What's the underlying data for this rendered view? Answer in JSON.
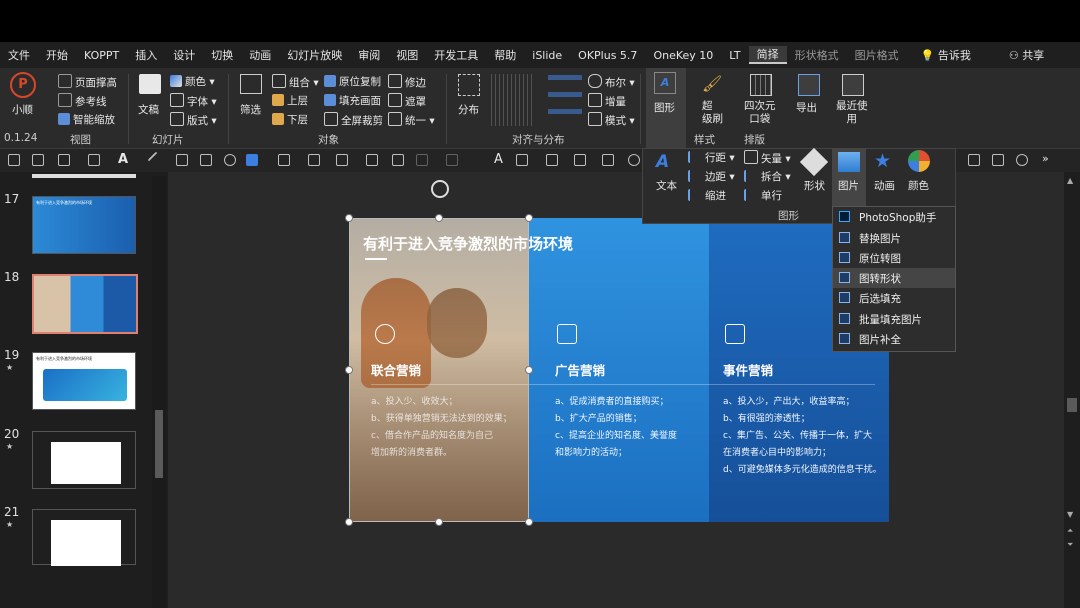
{
  "menubar": {
    "items": [
      {
        "label": "文件"
      },
      {
        "label": "开始"
      },
      {
        "label": "KOPPT"
      },
      {
        "label": "插入"
      },
      {
        "label": "设计"
      },
      {
        "label": "切换"
      },
      {
        "label": "动画"
      },
      {
        "label": "幻灯片放映"
      },
      {
        "label": "审阅"
      },
      {
        "label": "视图"
      },
      {
        "label": "开发工具"
      },
      {
        "label": "帮助"
      },
      {
        "label": "iSlide"
      },
      {
        "label": "OKPlus 5.7"
      },
      {
        "label": "OneKey 10"
      },
      {
        "label": "LT"
      },
      {
        "label": "简择"
      },
      {
        "label": "形状格式"
      },
      {
        "label": "图片格式"
      }
    ],
    "tell_me": "告诉我",
    "share": "共享"
  },
  "ribbon": {
    "xiaoshun": "小顺",
    "version": "0.1.24",
    "view_group": {
      "label": "视图",
      "items": [
        "页面撑高",
        "参考线",
        "智能缩放"
      ]
    },
    "slide_group": {
      "label": "幻灯片",
      "doc": "文稿",
      "items": [
        "颜色",
        "字体",
        "版式"
      ]
    },
    "object_group": {
      "label": "对象",
      "filter": "筛选",
      "items": [
        "组合",
        "上层",
        "下层",
        "原位复制",
        "填充画面",
        "全屏裁剪",
        "修边",
        "遮罩",
        "统一"
      ]
    },
    "align_group": {
      "label": "对齐与分布",
      "distribute": "分布",
      "items": [
        "布尔",
        "增量",
        "模式"
      ]
    },
    "shape_btn": "图形",
    "style_group": {
      "label": "样式",
      "super_brush": "超\n级刷"
    },
    "arrange_group": {
      "label": "排版",
      "fourd": "四次元\n口袋"
    },
    "export": "导出",
    "recent": "最近使\n用"
  },
  "shape_panel": {
    "label": "图形",
    "items": [
      "文本",
      "行距",
      "边距",
      "缩进",
      "矢量",
      "拆合",
      "单行",
      "形状",
      "图片",
      "动画",
      "颜色"
    ]
  },
  "picture_menu": {
    "items": [
      {
        "label": "PhotoShop助手",
        "icon": "ps-icon"
      },
      {
        "label": "替换图片",
        "icon": "image-icon"
      },
      {
        "label": "原位转图",
        "icon": "image-icon"
      },
      {
        "label": "图转形状",
        "icon": "image-icon"
      },
      {
        "label": "后选填充",
        "icon": "image-icon"
      },
      {
        "label": "批量填充图片",
        "icon": "grid-icon"
      },
      {
        "label": "图片补全",
        "icon": "image-icon"
      }
    ],
    "hovered": "图转形状"
  },
  "thumbnails": [
    {
      "num": "17",
      "title": "有利于进入竞争激烈的市场环境"
    },
    {
      "num": "18",
      "selected": true
    },
    {
      "num": "19",
      "title": "有利于进入竞争激烈的市场环境"
    },
    {
      "num": "20"
    },
    {
      "num": "21"
    }
  ],
  "slide": {
    "title": "有利于进入竞争激烈的市场环境",
    "columns": [
      {
        "heading": "联合营销",
        "lines": [
          "a、投入少、收效大；",
          "b、获得单独营销无法达到的效果；",
          "c、借合作产品的知名度为自己",
          "增加新的消费者群。"
        ]
      },
      {
        "heading": "广告营销",
        "lines": [
          "a、促成消费者的直接购买；",
          "b、扩大产品的销售；",
          "c、提高企业的知名度、美誉度",
          "和影响力的活动；"
        ]
      },
      {
        "heading": "事件营销",
        "lines": [
          "a、投入少，产出大，收益率高；",
          "b、有很强的渗透性；",
          "c、集广告、公关、传播于一体，扩大",
          "在消费者心目中的影响力；",
          "d、可避免媒体多元化造成的信息干扰。"
        ]
      }
    ]
  },
  "colors": {
    "accent": "#1b5da8",
    "menu_bg": "#2d2d2d"
  }
}
